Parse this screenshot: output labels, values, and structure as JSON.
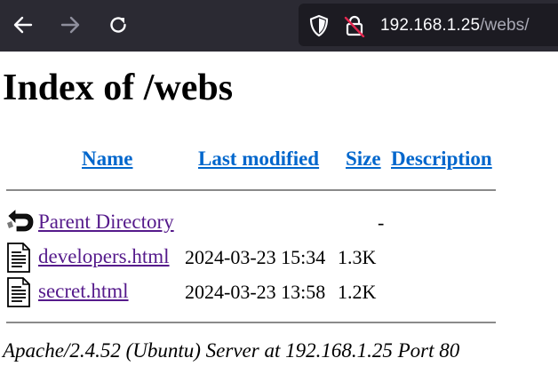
{
  "browser": {
    "url_host": "192.168.1.25",
    "url_path": "/webs/",
    "icons": [
      "back-arrow-icon",
      "forward-arrow-icon",
      "reload-icon",
      "shield-icon",
      "insecure-lock-icon"
    ]
  },
  "page": {
    "title": "Index of /webs",
    "columns": {
      "name": "Name",
      "last_modified": "Last modified",
      "size": "Size",
      "description": "Description"
    },
    "rows": [
      {
        "name": "Parent Directory",
        "modified": "",
        "size": "-",
        "icon": "back-folder-icon"
      },
      {
        "name": "developers.html",
        "modified": "2024-03-23 15:34",
        "size": "1.3K",
        "icon": "text-file-icon"
      },
      {
        "name": "secret.html",
        "modified": "2024-03-23 13:58",
        "size": "1.2K",
        "icon": "text-file-icon"
      }
    ],
    "footer": "Apache/2.4.52 (Ubuntu) Server at 192.168.1.25 Port 80"
  },
  "colors": {
    "toolbar_bg": "#2b2a33",
    "urlbar_bg": "#1c1b22",
    "link": "#0066cc",
    "visited_link": "#551a8b"
  }
}
